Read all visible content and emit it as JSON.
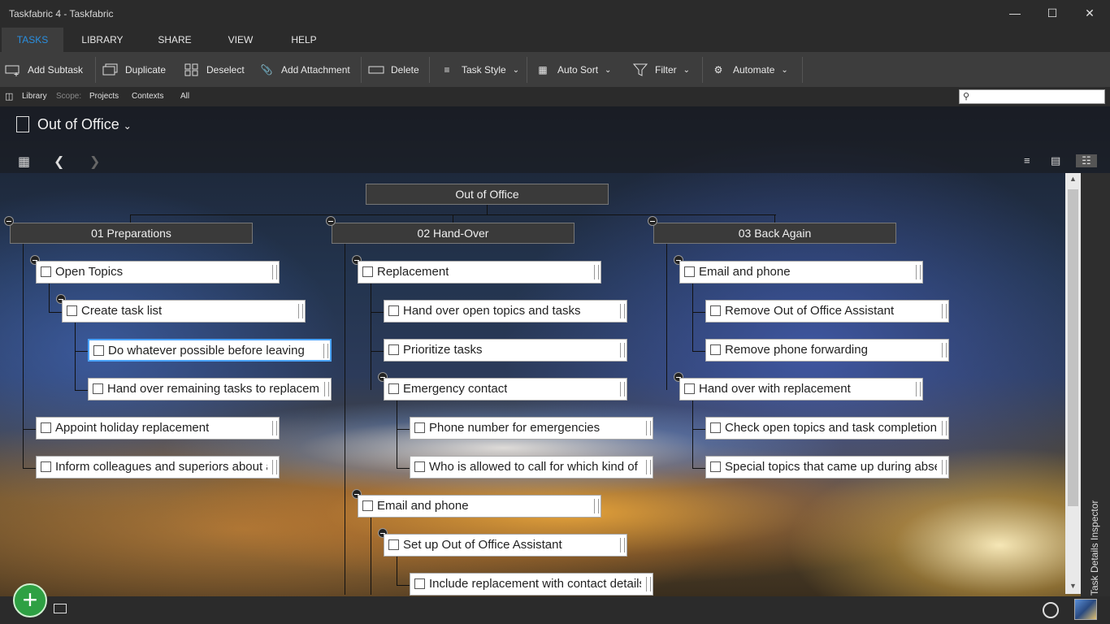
{
  "window": {
    "title": "Taskfabric 4 - Taskfabric"
  },
  "menu": {
    "tabs": [
      "TASKS",
      "LIBRARY",
      "SHARE",
      "VIEW",
      "HELP"
    ]
  },
  "toolbar": {
    "add_subtask": "Add Subtask",
    "duplicate": "Duplicate",
    "deselect": "Deselect",
    "add_attachment": "Add Attachment",
    "delete": "Delete",
    "task_style": "Task Style",
    "auto_sort": "Auto Sort",
    "filter": "Filter",
    "automate": "Automate"
  },
  "scope": {
    "library": "Library",
    "scope_label": "Scope:",
    "projects": "Projects",
    "contexts": "Contexts",
    "all": "All"
  },
  "search": {
    "placeholder": ""
  },
  "project": {
    "title": "Out of Office"
  },
  "mindmap": {
    "root": "Out of Office",
    "groups": [
      "01 Preparations",
      "02 Hand-Over",
      "03 Back Again"
    ],
    "tasks": {
      "open_topics": "Open Topics",
      "create_task_list": "Create task list",
      "do_whatever": "Do whatever possible before leaving",
      "hand_over_remaining": "Hand over remaining tasks to replacement",
      "appoint_holiday": "Appoint holiday replacement",
      "inform_colleagues": "Inform colleagues and superiors about absence",
      "replacement": "Replacement",
      "hand_over_open": "Hand over open topics and tasks",
      "prioritize": "Prioritize tasks",
      "emergency_contact": "Emergency contact",
      "phone_number": "Phone number for emergencies",
      "who_allowed": "Who is allowed to call for which kind of emergency",
      "email_phone_2": "Email and phone",
      "setup_ooo": "Set up Out of Office Assistant",
      "include_replacement": "Include replacement with contact details",
      "email_phone_3": "Email and phone",
      "remove_ooo": "Remove Out of Office Assistant",
      "remove_forwarding": "Remove phone forwarding",
      "hand_over_with": "Hand over with replacement",
      "check_open": "Check open topics and task completion",
      "special_topics": "Special topics that came up during absence"
    }
  },
  "inspector": {
    "label": "Task Details Inspector"
  },
  "colors": {
    "accent": "#2a8fe0",
    "add_button": "#2ea043"
  }
}
